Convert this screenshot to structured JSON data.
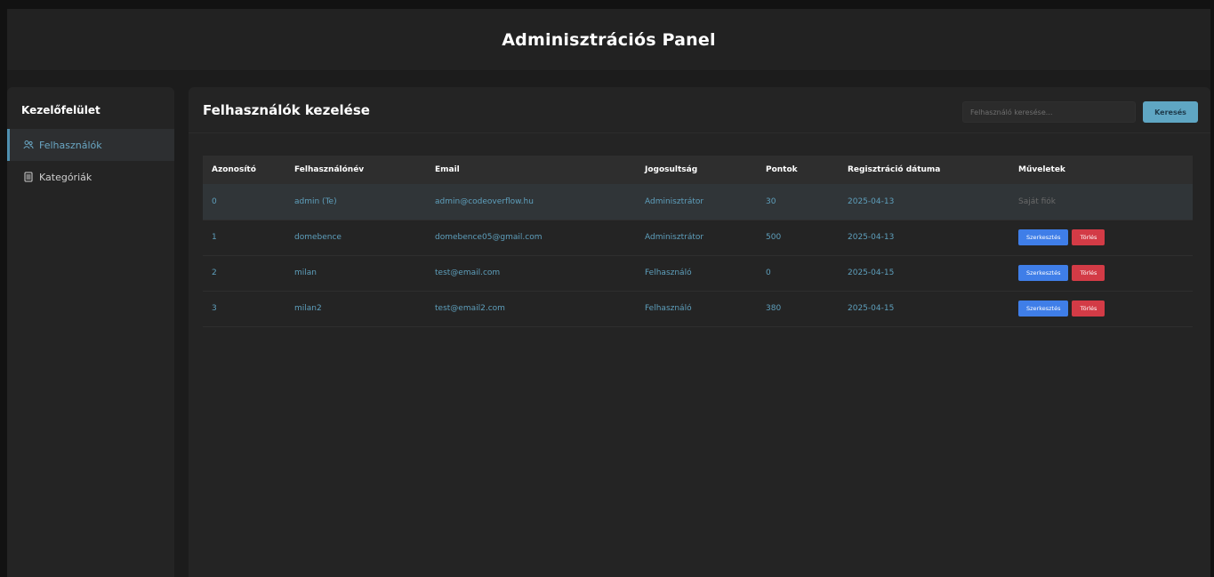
{
  "header": {
    "title": "Adminisztrációs Panel"
  },
  "sidebar": {
    "title": "Kezelőfelület",
    "items": [
      {
        "label": "Felhasználók",
        "icon": "users-icon",
        "active": true
      },
      {
        "label": "Kategóriák",
        "icon": "list-icon",
        "active": false
      }
    ]
  },
  "main": {
    "title": "Felhasználók kezelése",
    "search": {
      "placeholder": "Felhasználó keresése...",
      "button_label": "Keresés"
    },
    "table": {
      "columns": [
        "Azonosító",
        "Felhasználónév",
        "Email",
        "Jogosultság",
        "Pontok",
        "Regisztráció dátuma",
        "Műveletek"
      ],
      "rows": [
        {
          "id": "0",
          "username": "admin (Te)",
          "email": "admin@codeoverflow.hu",
          "role": "Adminisztrátor",
          "points": "30",
          "date": "2025-04-13",
          "action_text": "Saját fiók"
        },
        {
          "id": "1",
          "username": "domebence",
          "email": "domebence05@gmail.com",
          "role": "Adminisztrátor",
          "points": "500",
          "date": "2025-04-13",
          "edit_label": "Szerkesztés",
          "delete_label": "Törlés"
        },
        {
          "id": "2",
          "username": "milan",
          "email": "test@email.com",
          "role": "Felhasználó",
          "points": "0",
          "date": "2025-04-15",
          "edit_label": "Szerkesztés",
          "delete_label": "Törlés"
        },
        {
          "id": "3",
          "username": "milan2",
          "email": "test@email2.com",
          "role": "Felhasználó",
          "points": "380",
          "date": "2025-04-15",
          "edit_label": "Szerkesztés",
          "delete_label": "Törlés"
        }
      ]
    }
  },
  "colors": {
    "accent": "#5fa6c3",
    "edit": "#3f7ee8",
    "delete": "#d33b46"
  }
}
